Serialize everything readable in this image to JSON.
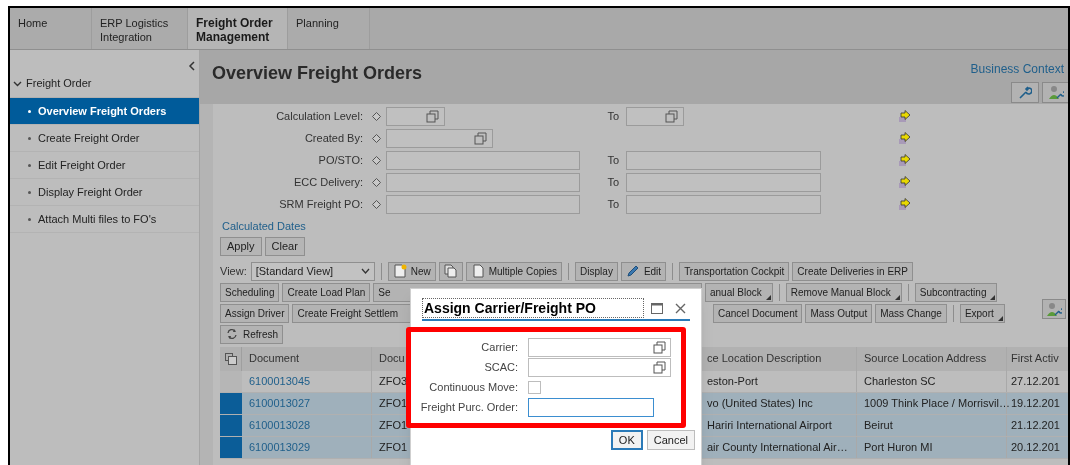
{
  "tabs": [
    {
      "label": "Home",
      "selected": false
    },
    {
      "label": "ERP Logistics Integration",
      "selected": false
    },
    {
      "label": "Freight Order Management",
      "selected": true
    },
    {
      "label": "Planning",
      "selected": false
    }
  ],
  "sidebar": {
    "group": {
      "label": "Freight Order",
      "expanded": true,
      "items": [
        {
          "label": "Overview Freight Orders",
          "selected": true
        },
        {
          "label": "Create Freight Order",
          "selected": false
        },
        {
          "label": "Edit Freight Order",
          "selected": false
        },
        {
          "label": "Display Freight Order",
          "selected": false
        },
        {
          "label": "Attach Multi files to FO's",
          "selected": false
        }
      ]
    }
  },
  "page_title": "Overview Freight Orders",
  "business_context_link": "Business Context",
  "search_criteria": [
    {
      "label": "Calculation Level:",
      "kind": "short_range",
      "to_label": "To"
    },
    {
      "label": "Created By:",
      "kind": "single"
    },
    {
      "label": "PO/STO:",
      "kind": "range",
      "to_label": "To"
    },
    {
      "label": "ECC Delivery:",
      "kind": "range",
      "to_label": "To"
    },
    {
      "label": "SRM Freight PO:",
      "kind": "range",
      "to_label": "To"
    }
  ],
  "calculated_dates_link": "Calculated Dates",
  "criteria_buttons": [
    "Apply",
    "Clear"
  ],
  "toolbar": {
    "view_label": "View:",
    "view_value": "[Standard View]",
    "rows": [
      {
        "left": [
          {
            "kind": "separator"
          },
          {
            "kind": "new_button",
            "label": "New"
          },
          {
            "kind": "copy_button"
          },
          {
            "kind": "copies_button",
            "label": "Multiple Copies"
          },
          {
            "kind": "separator"
          },
          {
            "kind": "button",
            "label": "Display"
          },
          {
            "kind": "edit_button",
            "label": "Edit"
          },
          {
            "kind": "separator"
          },
          {
            "kind": "button",
            "label": "Transportation Cockpit"
          },
          {
            "kind": "button",
            "label": "Create Deliveries in ERP"
          }
        ]
      },
      {
        "left": [
          {
            "kind": "button",
            "label": "Scheduling"
          },
          {
            "kind": "button",
            "label": "Create Load Plan"
          },
          {
            "kind": "cut_button",
            "label": "Se"
          }
        ],
        "right": [
          {
            "kind": "menu_button",
            "label": "anual Block"
          },
          {
            "kind": "separator"
          },
          {
            "kind": "menu_button",
            "label": "Remove Manual Block"
          },
          {
            "kind": "separator"
          },
          {
            "kind": "menu_button",
            "label": "Subcontracting"
          }
        ]
      },
      {
        "left": [
          {
            "kind": "button",
            "label": "Assign Driver"
          },
          {
            "kind": "cut_button",
            "label": "Create Freight Settlem"
          }
        ],
        "right": [
          {
            "kind": "button",
            "label": "Cancel Document"
          },
          {
            "kind": "button",
            "label": "Mass Output"
          },
          {
            "kind": "button",
            "label": "Mass Change"
          },
          {
            "kind": "separator"
          },
          {
            "kind": "menu_button",
            "label": "Export"
          }
        ]
      },
      {
        "left": [
          {
            "kind": "refresh_button",
            "label": "Refresh"
          }
        ]
      }
    ]
  },
  "table": {
    "columns": [
      "Document",
      "Docu",
      "ce Location Description",
      "Source Location Address",
      "First Activ"
    ],
    "rows": [
      {
        "selected": false,
        "cells": [
          "6100013045",
          "ZFO3",
          "eston-Port",
          "Charleston SC",
          "27.12.201"
        ]
      },
      {
        "selected": true,
        "cells": [
          "6100013027",
          "ZFO1",
          "vo (United States) Inc",
          "1009 Think Place / Morrisvil…",
          "19.12.201"
        ]
      },
      {
        "selected": true,
        "cells": [
          "6100013028",
          "ZFO1",
          "Hariri International Airport",
          "Beirut",
          "21.12.201"
        ]
      },
      {
        "selected": true,
        "cells": [
          "6100013029",
          "ZFO1",
          "air County International Air…",
          "Port Huron MI",
          "20.12.201"
        ]
      }
    ]
  },
  "dialog": {
    "title": "Assign Carrier/Freight PO",
    "fields": [
      {
        "label": "Carrier:",
        "kind": "value_help"
      },
      {
        "label": "SCAC:",
        "kind": "value_help"
      },
      {
        "label": "Continuous Move:",
        "kind": "checkbox",
        "checked": false
      },
      {
        "label": "Freight Purc. Order:",
        "kind": "input",
        "focused": true
      }
    ],
    "buttons": [
      {
        "label": "OK",
        "default": true
      },
      {
        "label": "Cancel",
        "default": false
      }
    ]
  }
}
